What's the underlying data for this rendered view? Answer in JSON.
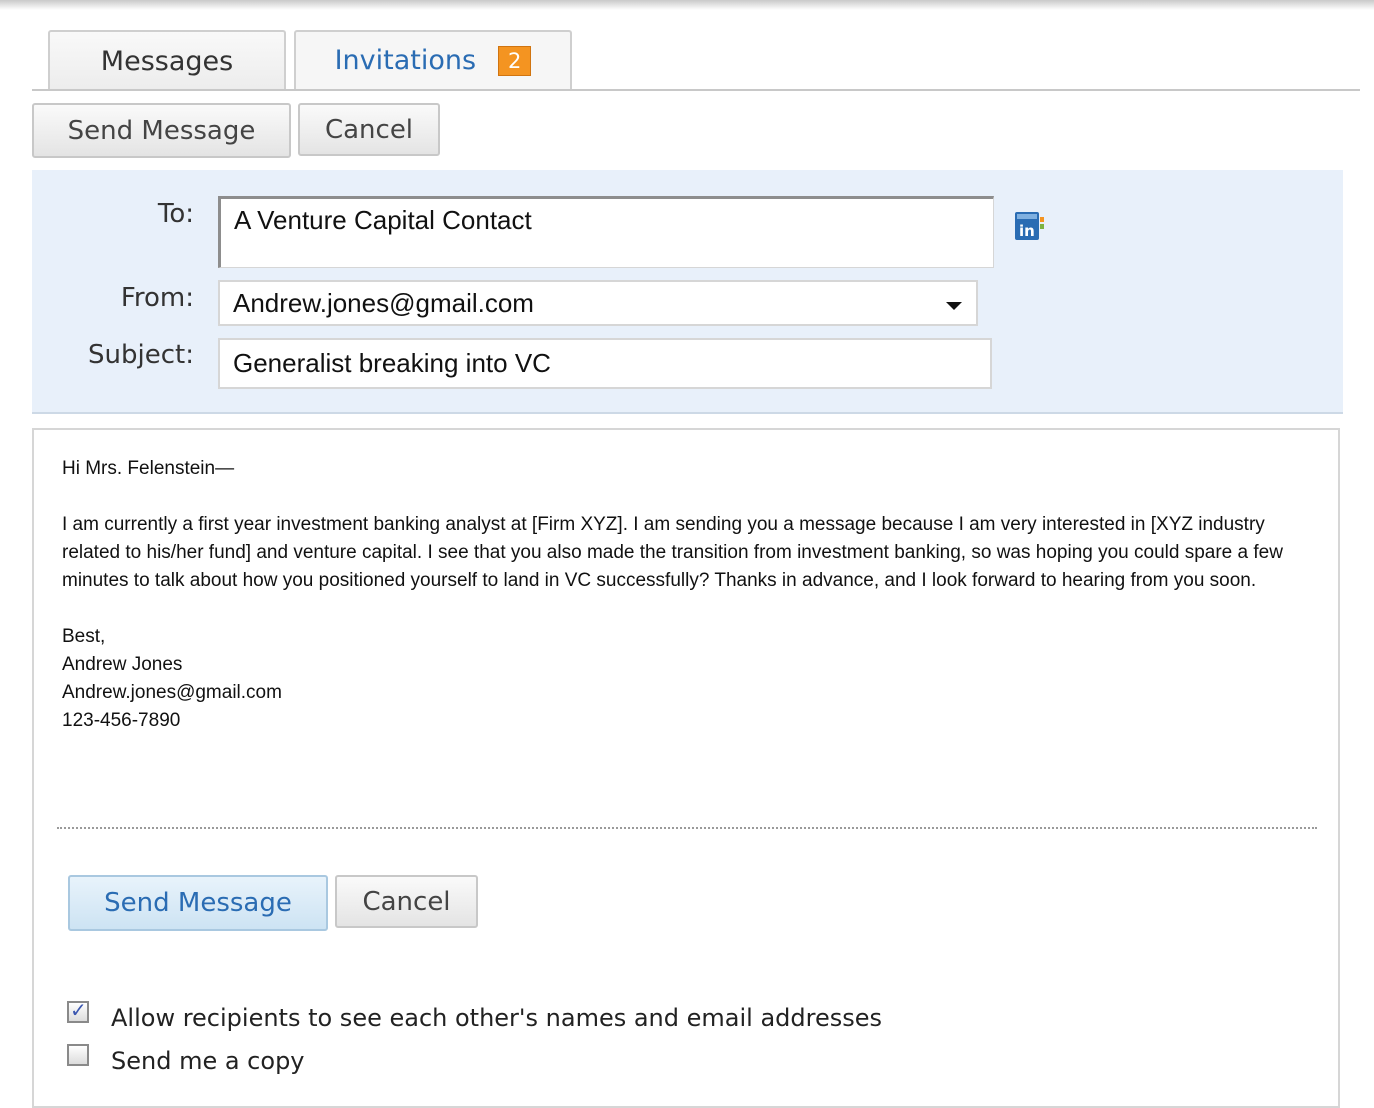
{
  "tabs": [
    {
      "label": "Messages",
      "active": true
    },
    {
      "label": "Invitations",
      "badge": "2",
      "active": false
    }
  ],
  "toolbar": {
    "send_label": "Send Message",
    "cancel_label": "Cancel"
  },
  "form": {
    "to_label": "To:",
    "to_value": "A Venture Capital Contact",
    "from_label": "From:",
    "from_value": "Andrew.jones@gmail.com",
    "subject_label": "Subject:",
    "subject_value": "Generalist breaking into VC"
  },
  "message": {
    "greeting": "Hi Mrs. Felenstein—",
    "body": "I am currently a first year investment banking analyst at [Firm XYZ]. I am sending you a message because I am very interested in [XYZ industry related to his/her fund] and venture capital.  I see that you also made the transition from investment banking, so was hoping you could spare a few minutes to talk about how you positioned yourself to land in VC successfully?  Thanks in advance, and I look forward to hearing from you soon.",
    "signoff": "Best,",
    "name": "Andrew Jones",
    "email": "Andrew.jones@gmail.com",
    "phone": "123-456-7890"
  },
  "bottom_actions": {
    "send_label": "Send Message",
    "cancel_label": "Cancel"
  },
  "options": [
    {
      "label": "Allow recipients to see each other's names and email addresses",
      "checked": true
    },
    {
      "label": "Send me a copy",
      "checked": false
    }
  ],
  "colors": {
    "accent": "#2a6cb3",
    "badge": "#f49421",
    "panel": "#e8f0fa"
  },
  "icons": {
    "address_book": "linkedin-address-book-icon"
  }
}
